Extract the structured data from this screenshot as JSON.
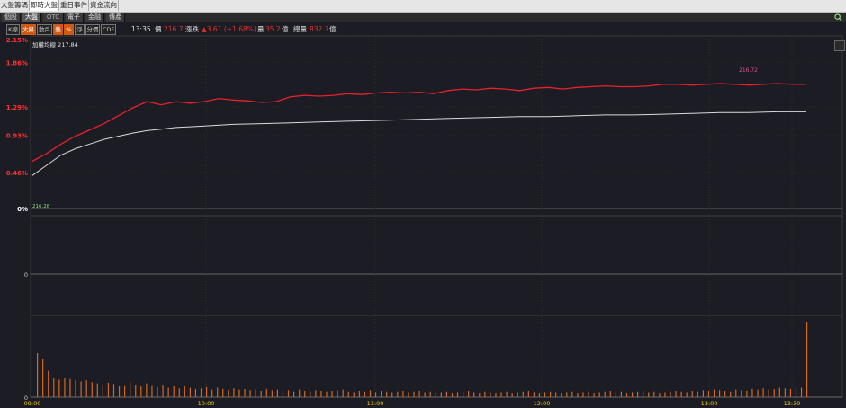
{
  "top_tabs": [
    "大盤籌碼",
    "即時大盤",
    "重日事件",
    "資金流向"
  ],
  "category_tabs": [
    "個股",
    "大盤",
    "OTC",
    "電子",
    "金融",
    "傳產"
  ],
  "tool_buttons": [
    "K線",
    "大昇",
    "散戶",
    "熱",
    "%",
    "淨",
    "分價",
    "CDF"
  ],
  "info": {
    "time": "13:35",
    "price_label": "價",
    "price_value": "216.7",
    "change_label": "漲跌",
    "change_value": "▲3.61 (+1.68%)",
    "volume_label": "量",
    "volume_value": "35.2",
    "volume_unit": "億",
    "total_label": "總量",
    "total_value": "832.7",
    "total_unit": "億"
  },
  "panel_label": "加權均線 217.84",
  "colors": {
    "price_line": "#e8212b",
    "avg_line": "#d9d9d9",
    "volume_bar": "#d4691e",
    "axis_pct": "#ff3030",
    "neutral": "#ffffff"
  },
  "chart_data": {
    "type": "line",
    "title": "",
    "y_ticks": [
      "2.15%",
      "1.86%",
      "1.29%",
      "0.93%",
      "0.46%"
    ],
    "zero_label": "0%",
    "base_price_label": "216.28",
    "high_label": "216.72",
    "middle_zero_label": "0",
    "volume_zero_label": "0",
    "x_ticks": [
      "09:00",
      "10:00",
      "11:00",
      "12:00",
      "13:00",
      "13:30"
    ],
    "ylim_pct": [
      0,
      2.15
    ],
    "series": [
      {
        "values": [
          [
            0,
            0.6
          ],
          [
            5,
            0.7
          ],
          [
            10,
            0.82
          ],
          [
            15,
            0.92
          ],
          [
            20,
            1.0
          ],
          [
            25,
            1.08
          ],
          [
            30,
            1.18
          ],
          [
            35,
            1.28
          ],
          [
            40,
            1.36
          ],
          [
            45,
            1.32
          ],
          [
            50,
            1.36
          ],
          [
            55,
            1.34
          ],
          [
            60,
            1.36
          ],
          [
            65,
            1.4
          ],
          [
            70,
            1.38
          ],
          [
            75,
            1.37
          ],
          [
            80,
            1.35
          ],
          [
            85,
            1.36
          ],
          [
            90,
            1.42
          ],
          [
            95,
            1.44
          ],
          [
            100,
            1.43
          ],
          [
            105,
            1.44
          ],
          [
            110,
            1.46
          ],
          [
            115,
            1.45
          ],
          [
            120,
            1.47
          ],
          [
            125,
            1.48
          ],
          [
            130,
            1.47
          ],
          [
            135,
            1.48
          ],
          [
            140,
            1.46
          ],
          [
            145,
            1.5
          ],
          [
            150,
            1.52
          ],
          [
            155,
            1.51
          ],
          [
            160,
            1.53
          ],
          [
            165,
            1.52
          ],
          [
            170,
            1.5
          ],
          [
            175,
            1.53
          ],
          [
            180,
            1.54
          ],
          [
            185,
            1.52
          ],
          [
            190,
            1.54
          ],
          [
            195,
            1.55
          ],
          [
            200,
            1.56
          ],
          [
            205,
            1.55
          ],
          [
            210,
            1.55
          ],
          [
            215,
            1.56
          ],
          [
            220,
            1.58
          ],
          [
            225,
            1.58
          ],
          [
            230,
            1.57
          ],
          [
            235,
            1.58
          ],
          [
            240,
            1.59
          ],
          [
            245,
            1.58
          ],
          [
            250,
            1.57
          ],
          [
            255,
            1.58
          ],
          [
            260,
            1.59
          ],
          [
            265,
            1.58
          ],
          [
            270,
            1.58
          ]
        ]
      },
      {
        "values": [
          [
            0,
            0.42
          ],
          [
            5,
            0.55
          ],
          [
            10,
            0.68
          ],
          [
            15,
            0.76
          ],
          [
            20,
            0.82
          ],
          [
            25,
            0.88
          ],
          [
            30,
            0.92
          ],
          [
            35,
            0.96
          ],
          [
            40,
            0.99
          ],
          [
            45,
            1.01
          ],
          [
            50,
            1.03
          ],
          [
            55,
            1.04
          ],
          [
            60,
            1.05
          ],
          [
            70,
            1.07
          ],
          [
            80,
            1.08
          ],
          [
            90,
            1.09
          ],
          [
            100,
            1.1
          ],
          [
            110,
            1.11
          ],
          [
            120,
            1.12
          ],
          [
            130,
            1.13
          ],
          [
            140,
            1.14
          ],
          [
            150,
            1.15
          ],
          [
            160,
            1.16
          ],
          [
            170,
            1.17
          ],
          [
            180,
            1.17
          ],
          [
            190,
            1.18
          ],
          [
            200,
            1.19
          ],
          [
            210,
            1.19
          ],
          [
            220,
            1.2
          ],
          [
            230,
            1.21
          ],
          [
            240,
            1.22
          ],
          [
            250,
            1.22
          ],
          [
            260,
            1.23
          ],
          [
            270,
            1.23
          ]
        ]
      }
    ],
    "volume": [
      70,
      60,
      42,
      30,
      28,
      30,
      29,
      27,
      25,
      27,
      24,
      22,
      20,
      23,
      21,
      18,
      19,
      24,
      20,
      17,
      22,
      19,
      16,
      20,
      15,
      18,
      14,
      17,
      15,
      13,
      14,
      16,
      12,
      15,
      13,
      11,
      14,
      12,
      13,
      11,
      12,
      10,
      13,
      11,
      12,
      10,
      11,
      9,
      12,
      10,
      9,
      11,
      10,
      9,
      10,
      11,
      12,
      9,
      8,
      10,
      9,
      11,
      8,
      10,
      9,
      8,
      9,
      10,
      8,
      9,
      10,
      8,
      9,
      7,
      8,
      9,
      7,
      8,
      9,
      10,
      8,
      7,
      9,
      8,
      7,
      8,
      9,
      7,
      8,
      9,
      10,
      8,
      7,
      8,
      9,
      8,
      7,
      8,
      9,
      7,
      8,
      9,
      7,
      8,
      9,
      10,
      8,
      9,
      7,
      8,
      9,
      10,
      8,
      9,
      7,
      8,
      9,
      10,
      9,
      8,
      10,
      9,
      11,
      10,
      12,
      11,
      10,
      9,
      12,
      11,
      10,
      13,
      12,
      14,
      12,
      13,
      15,
      14,
      13,
      16,
      15,
      120
    ]
  }
}
